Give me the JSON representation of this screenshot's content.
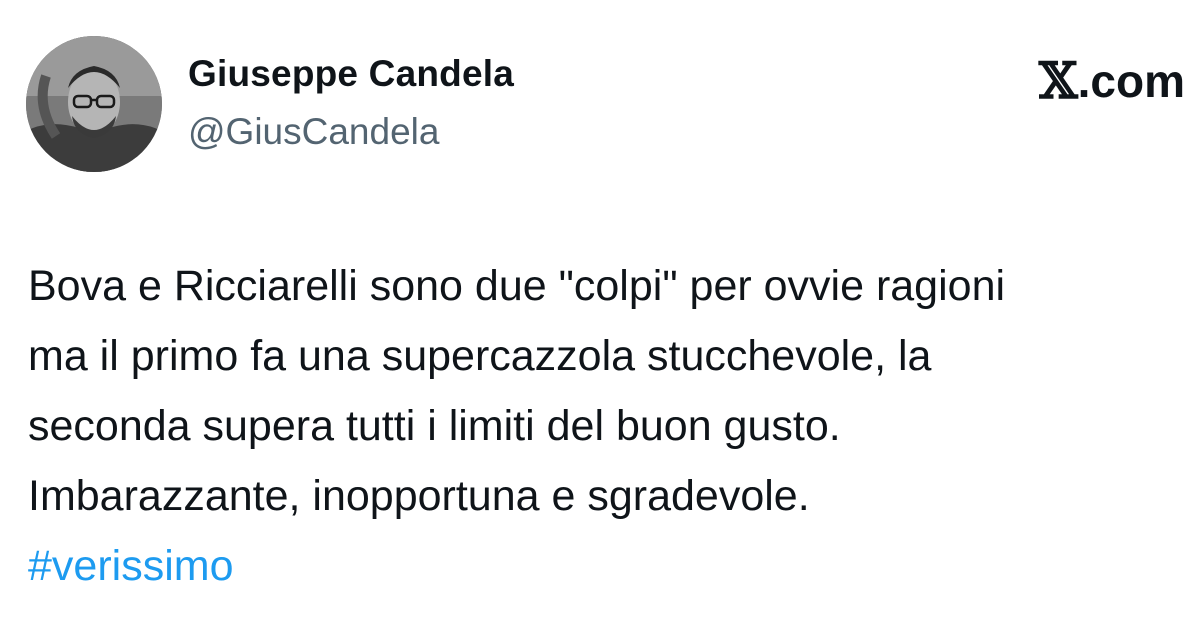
{
  "author": {
    "name": "Giuseppe Candela",
    "handle": "@GiusCandela",
    "avatar_icon": "user-avatar-photo"
  },
  "brand": {
    "logo_glyph": "𝕏",
    "domain": ".com",
    "logo_icon": "x-logo-icon"
  },
  "tweet": {
    "lines": [
      "Bova e Ricciarelli sono due \"colpi\" per ovvie ragioni",
      "ma il primo fa una supercazzola stucchevole, la",
      "seconda supera tutti i limiti del buon gusto.",
      "Imbarazzante, inopportuna e sgradevole."
    ],
    "hashtag": "#verissimo"
  },
  "colors": {
    "text": "#0f1419",
    "handle": "#536471",
    "hashtag": "#1d9bf0",
    "background": "#ffffff"
  }
}
